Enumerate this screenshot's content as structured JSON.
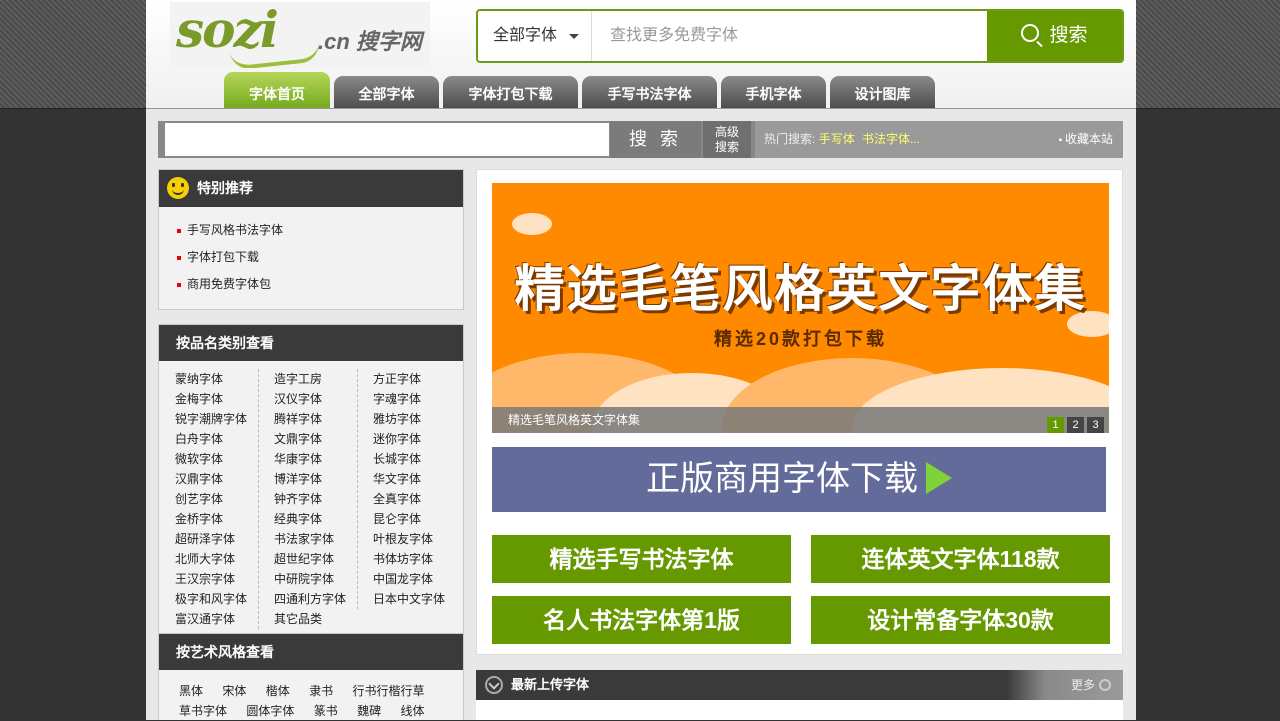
{
  "header": {
    "logo_main": "sozi",
    "logo_cn": ".cn 搜字网",
    "search": {
      "select_value": "全部字体",
      "placeholder": "查找更多免费字体",
      "button_label": "搜索"
    },
    "nav": [
      {
        "label": "字体首页",
        "active": true
      },
      {
        "label": "全部字体"
      },
      {
        "label": "字体打包下载"
      },
      {
        "label": "手写书法字体"
      },
      {
        "label": "手机字体"
      },
      {
        "label": "设计图库"
      }
    ]
  },
  "searchbar2": {
    "search_label": "搜 索",
    "advanced_label_1": "高级",
    "advanced_label_2": "搜索",
    "hot_label": "热门搜索:",
    "hot_keywords": [
      "手写体",
      "书法字体..."
    ],
    "favorite_label": "收藏本站"
  },
  "recommend": {
    "title": "特别推荐",
    "items": [
      "手写风格书法字体",
      "字体打包下载",
      "商用免费字体包"
    ]
  },
  "brands": {
    "title": "按品名类别查看",
    "col1": [
      "蒙纳字体",
      "金梅字体",
      "锐字潮牌字体",
      "白舟字体",
      "微软字体",
      "汉鼎字体",
      "创艺字体",
      "金桥字体",
      "超研泽字体",
      "北师大字体",
      "王汉宗字体",
      "极字和风字体",
      "富汉通字体"
    ],
    "col2": [
      "造字工房",
      "汉仪字体",
      "腾祥字体",
      "文鼎字体",
      "华康字体",
      "博洋字体",
      "钟齐字体",
      "经典字体",
      "书法家字体",
      "超世纪字体",
      "中研院字体",
      "四通利方字体",
      "其它品类"
    ],
    "col3": [
      "方正字体",
      "字魂字体",
      "雅坊字体",
      "迷你字体",
      "长城字体",
      "华文字体",
      "全真字体",
      "昆仑字体",
      "叶根友字体",
      "书体坊字体",
      "中国龙字体",
      "日本中文字体"
    ]
  },
  "styles": {
    "title": "按艺术风格查看",
    "row1": [
      "黑体",
      "宋体",
      "楷体",
      "隶书",
      "行书行楷行草"
    ],
    "row2": [
      "草书字体",
      "圆体字体",
      "篆书",
      "魏碑",
      "线体"
    ]
  },
  "banner": {
    "title": "精选毛笔风格英文字体集",
    "subtitle": "精选20款打包下载",
    "caption": "精选毛笔风格英文字体集",
    "pages": [
      "1",
      "2",
      "3"
    ],
    "active_page": "1"
  },
  "ads": {
    "blue": "正版商用字体下载",
    "green": [
      "精选手写书法字体",
      "连体英文字体118款",
      "名人书法字体第1版",
      "设计常备字体30款"
    ]
  },
  "latest": {
    "title": "最新上传字体",
    "more_label": "更多"
  },
  "colors": {
    "accent_green": "#669900",
    "banner_orange": "#ff8a00",
    "ad_blue": "#636b9b",
    "dark_header": "#3a3a3a"
  }
}
